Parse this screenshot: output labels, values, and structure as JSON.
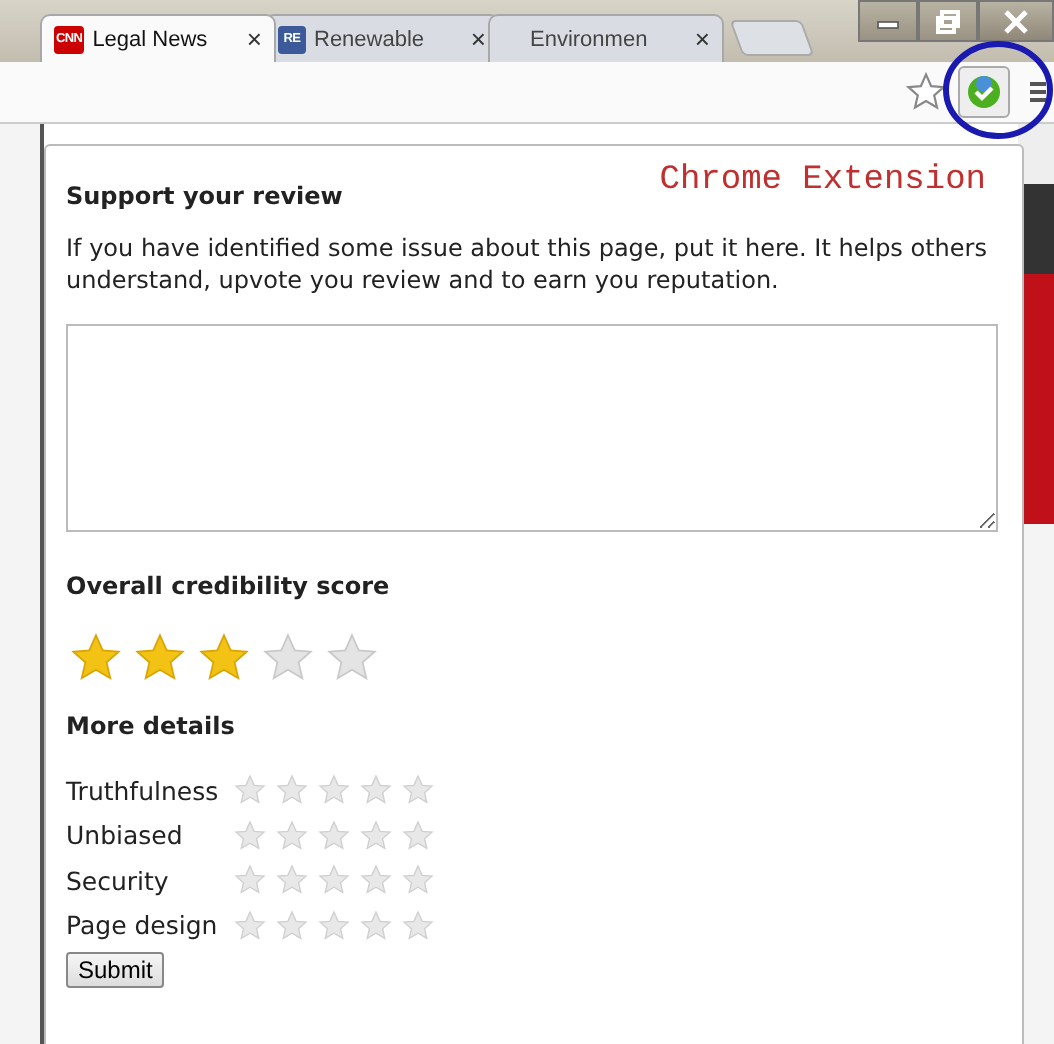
{
  "tabs": [
    {
      "title": "Legal News",
      "close": "×",
      "selected": true,
      "kind": "news",
      "logo": "CNN"
    },
    {
      "title": "Renewable",
      "close": "×",
      "selected": false,
      "kind": "energy",
      "logo": "RE"
    },
    {
      "title": "Environmen",
      "close": "×",
      "selected": false
    }
  ],
  "annotation": "Chrome Extension",
  "review": {
    "heading": "Support your review",
    "text": "If you have identified some issue about this page, put it here. It helps others understand, upvote you review and to earn you reputation."
  },
  "credibility": {
    "heading": "Overall credibility score",
    "stars": 3
  },
  "details": {
    "heading": "More details",
    "rows": [
      {
        "label": "Truthfulness",
        "stars": 0
      },
      {
        "label": "Unbiased",
        "stars": 0
      },
      {
        "label": "Security",
        "stars": 0
      },
      {
        "label": "Page design",
        "stars": 0
      }
    ]
  },
  "submit": "Submit"
}
